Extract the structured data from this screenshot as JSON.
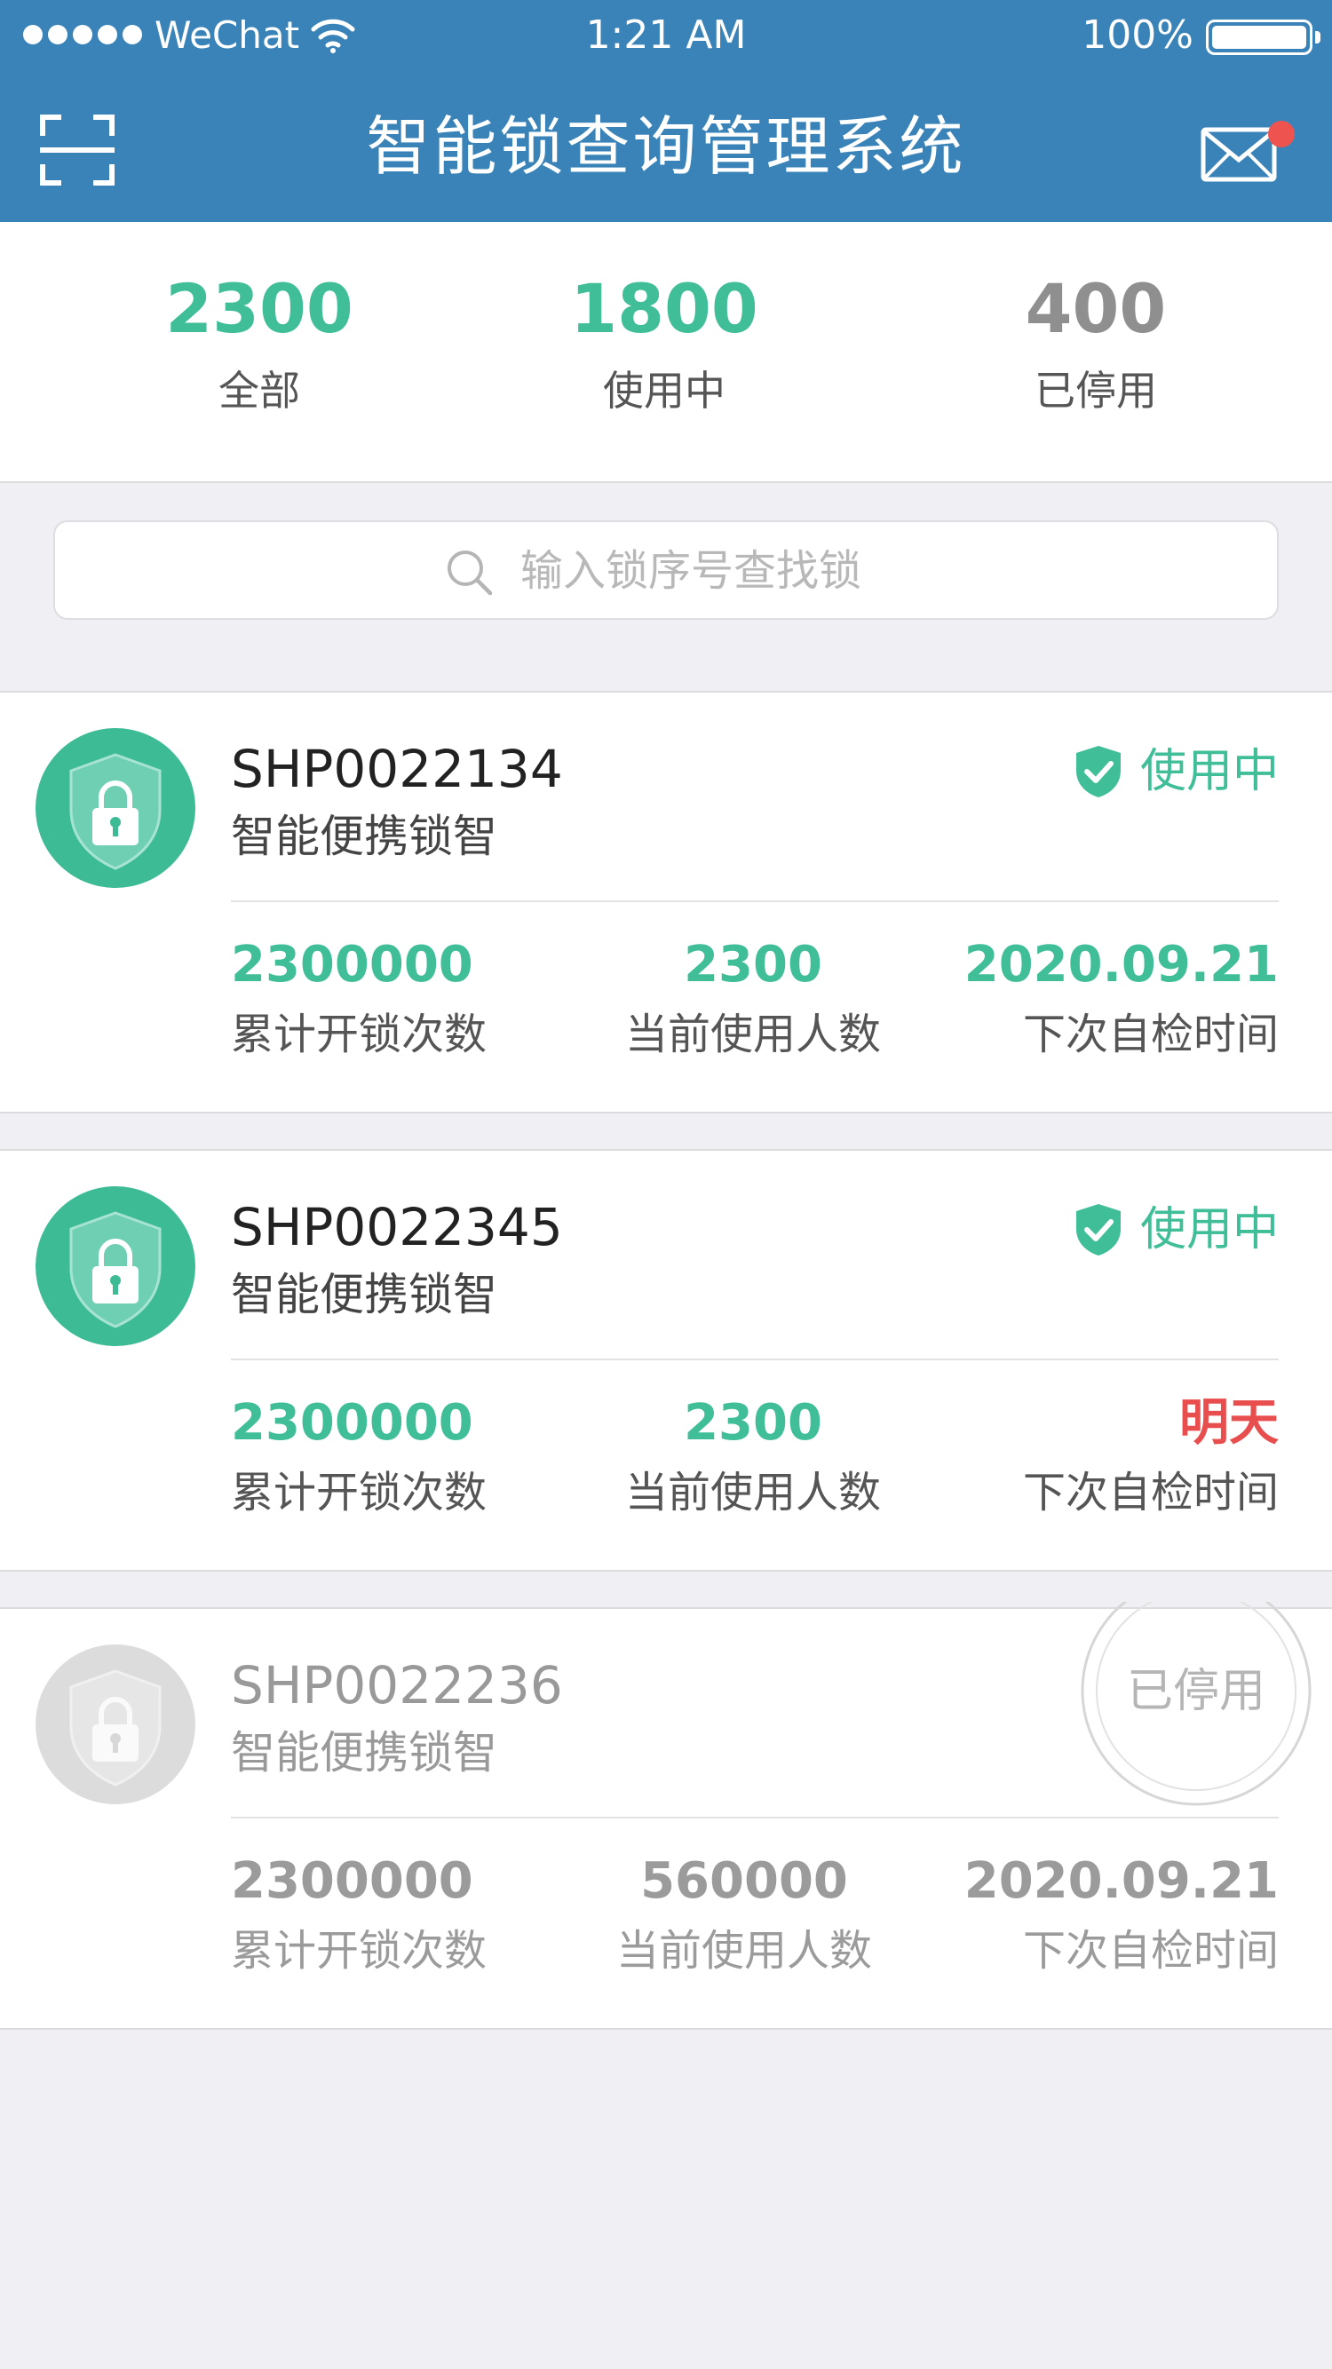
{
  "status_bar": {
    "carrier": "WeChat",
    "time": "1:21 AM",
    "battery": "100%"
  },
  "header": {
    "title": "智能锁查询管理系统",
    "has_unread": true
  },
  "stats": [
    {
      "value": "2300",
      "label": "全部"
    },
    {
      "value": "1800",
      "label": "使用中"
    },
    {
      "value": "400",
      "label": "已停用"
    }
  ],
  "search": {
    "placeholder": "输入锁序号查找锁"
  },
  "locks": [
    {
      "serial": "SHP0022134",
      "model": "智能便携锁智",
      "status": "使用中",
      "metrics": [
        {
          "value": "2300000",
          "label": "累计开锁次数"
        },
        {
          "value": "2300",
          "label": "当前使用人数"
        },
        {
          "value": "2020.09.21",
          "label": "下次自检时间"
        }
      ]
    },
    {
      "serial": "SHP0022345",
      "model": "智能便携锁智",
      "status": "使用中",
      "metrics": [
        {
          "value": "2300000",
          "label": "累计开锁次数"
        },
        {
          "value": "2300",
          "label": "当前使用人数"
        },
        {
          "value": "明天",
          "label": "下次自检时间"
        }
      ]
    },
    {
      "serial": "SHP0022236",
      "model": "智能便携锁智",
      "status": "已停用",
      "metrics": [
        {
          "value": "2300000",
          "label": "累计开锁次数"
        },
        {
          "value": "560000",
          "label": "当前使用人数"
        },
        {
          "value": "2020.09.21",
          "label": "下次自检时间"
        }
      ]
    }
  ],
  "colors": {
    "header": "#3a83b8",
    "accent": "#3fbe98",
    "warning": "#e94e4e",
    "disabled": "#9b9b9b"
  }
}
